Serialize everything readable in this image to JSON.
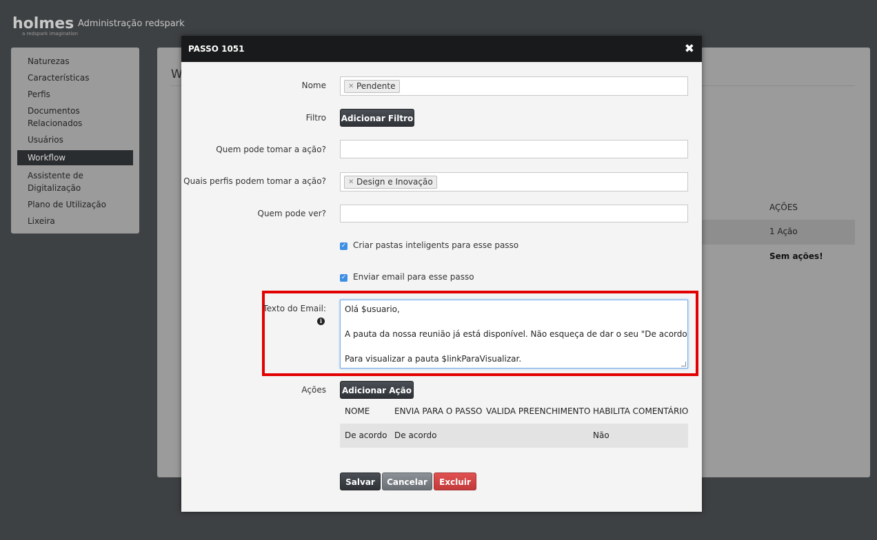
{
  "header": {
    "logo": "holmes",
    "logo_tagline": "a redspark imagination",
    "app_title": "Administração redspark"
  },
  "sidebar": {
    "items": [
      {
        "label": "Naturezas"
      },
      {
        "label": "Características"
      },
      {
        "label": "Perfis"
      },
      {
        "label": "Documentos\nRelacionados"
      },
      {
        "label": "Usuários"
      },
      {
        "label": "Workflow",
        "active": true
      },
      {
        "label": "Assistente de\nDigitalização"
      },
      {
        "label": "Plano de Utilização"
      },
      {
        "label": "Lixeira"
      }
    ]
  },
  "background_panel": {
    "heading_partial": "W",
    "column_header": "AÇÕES",
    "row1_value": "1 Ação",
    "row2_value": "Sem ações!"
  },
  "modal": {
    "title": "PASSO 1051",
    "close_icon": "close-icon",
    "fields": {
      "nome_label": "Nome",
      "nome_tag": "Pendente",
      "filtro_label": "Filtro",
      "filtro_button": "Adicionar Filtro",
      "quem_tomar_label": "Quem pode tomar a ação?",
      "quem_tomar_value": "",
      "perfis_label": "Quais perfis podem tomar a ação?",
      "perfis_tag": "Design e Inovação",
      "quem_ver_label": "Quem pode ver?",
      "quem_ver_value": ""
    },
    "checkboxes": {
      "pastas_label": "Criar pastas inteligents para esse passo",
      "pastas_checked": true,
      "email_label": "Enviar email para esse passo",
      "email_checked": true
    },
    "email": {
      "label": "Texto do Email:",
      "lines": [
        "Olá $usuario,",
        "",
        "A pauta da nossa reunião já está disponível. Não esqueça de dar o seu \"De acordo\".",
        "",
        "Para visualizar a pauta $linkParaVisualizar."
      ]
    },
    "acoes": {
      "label": "Ações",
      "button": "Adicionar Ação",
      "columns": [
        "NOME",
        "ENVIA PARA O PASSO",
        "VALIDA PREENCHIMENTO",
        "HABILITA COMENTÁRIO"
      ],
      "rows": [
        [
          "De acordo",
          "De acordo",
          "",
          "Não"
        ]
      ]
    },
    "footer": {
      "save": "Salvar",
      "cancel": "Cancelar",
      "delete": "Excluir"
    }
  },
  "colors": {
    "highlight": "#e20000",
    "primary_button": "#2f3338",
    "danger_button": "#c23a3a",
    "checkbox": "#3d8ee4"
  }
}
